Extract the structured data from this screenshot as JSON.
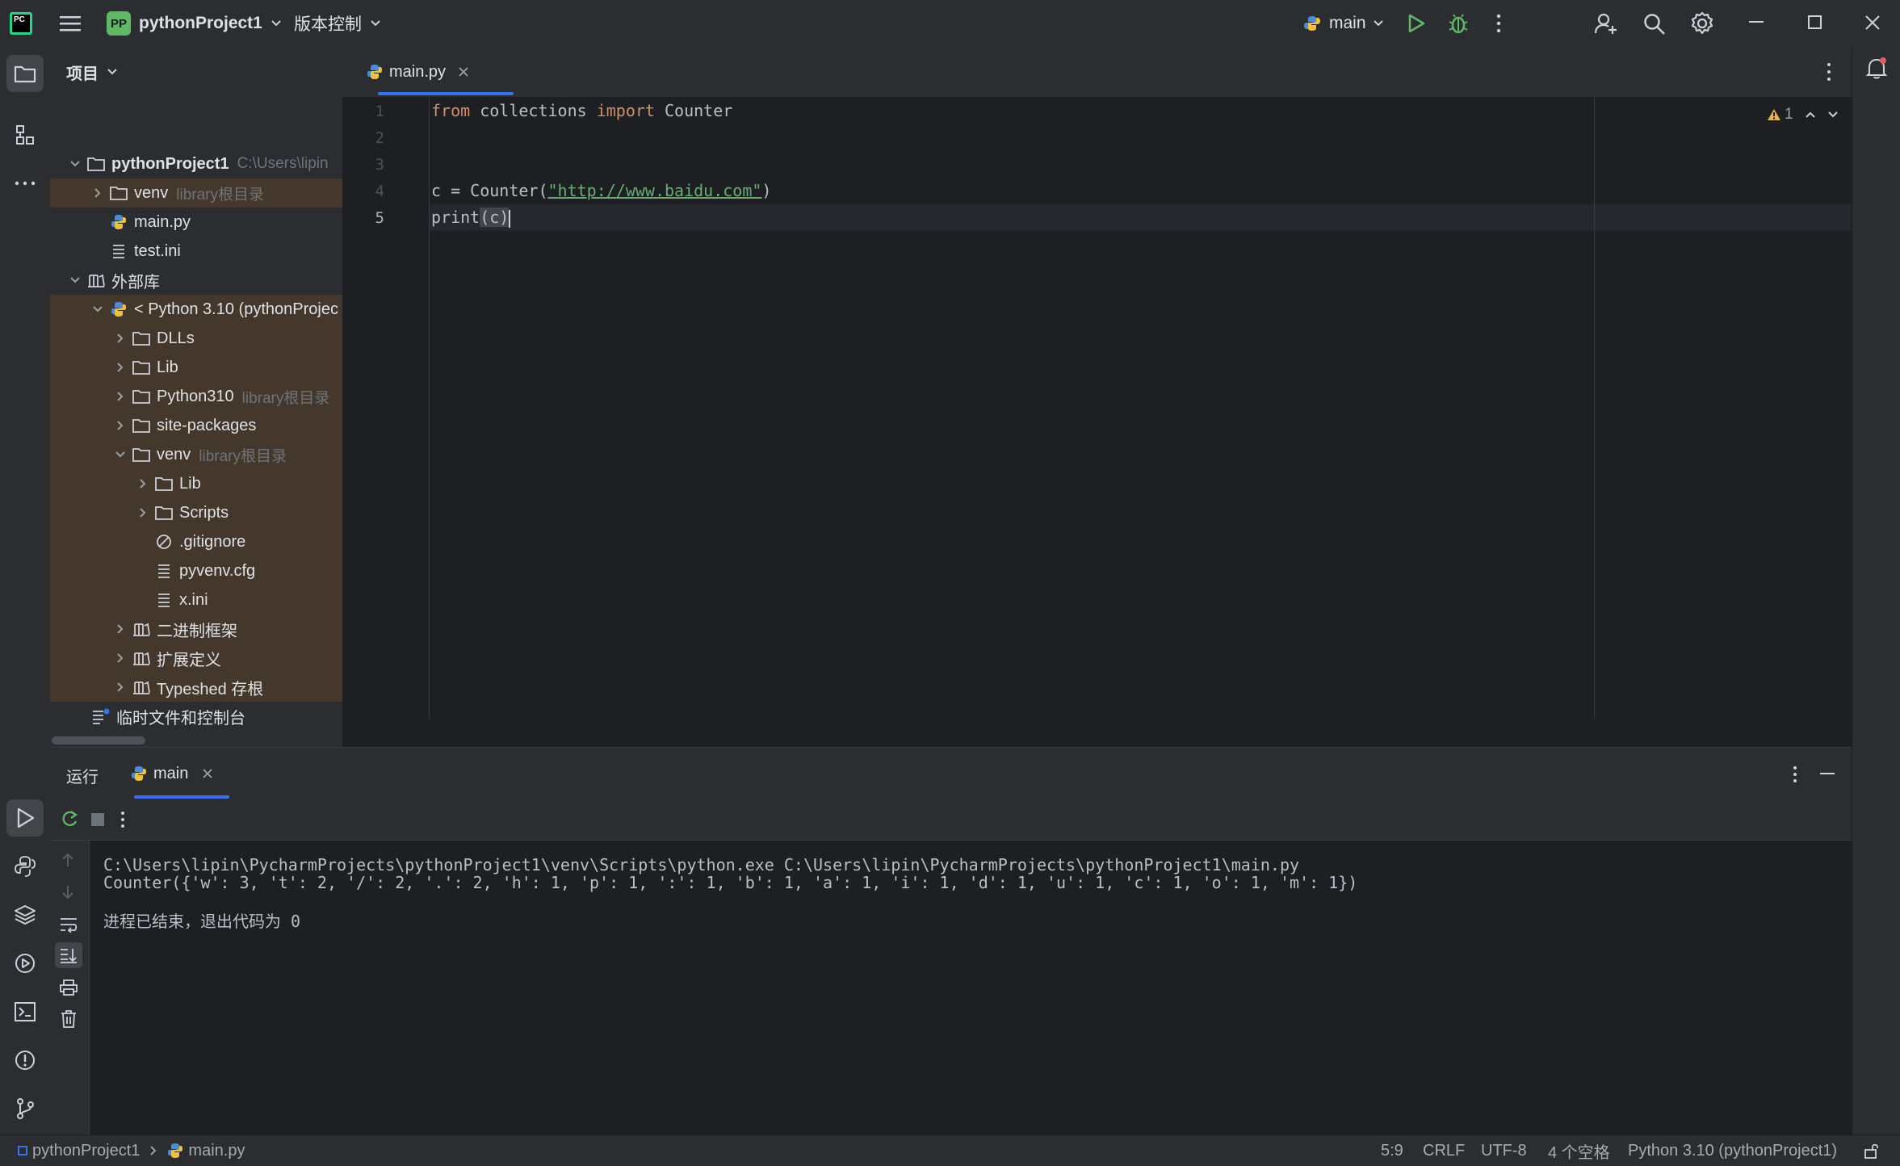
{
  "titlebar": {
    "logo_text": "PC",
    "project_badge": "PP",
    "project_name": "pythonProject1",
    "vcs_label": "版本控制",
    "run_config": "main"
  },
  "project_panel": {
    "header": "项目",
    "tree": [
      {
        "label": "pythonProject1",
        "hint": "C:\\Users\\lipin",
        "icon": "folder-icon"
      },
      {
        "label": "venv",
        "hint": "library根目录",
        "icon": "folder-icon"
      },
      {
        "label": "main.py",
        "hint": "",
        "icon": "python-file-icon"
      },
      {
        "label": "test.ini",
        "hint": "",
        "icon": "text-file-icon"
      },
      {
        "label": "外部库",
        "hint": "",
        "icon": "library-icon"
      },
      {
        "label": "< Python 3.10 (pythonProjec",
        "hint": "",
        "icon": "python-sdk-icon"
      },
      {
        "label": "DLLs",
        "hint": "",
        "icon": "folder-icon"
      },
      {
        "label": "Lib",
        "hint": "",
        "icon": "folder-icon"
      },
      {
        "label": "Python310",
        "hint": "library根目录",
        "icon": "folder-icon"
      },
      {
        "label": "site-packages",
        "hint": "",
        "icon": "folder-icon"
      },
      {
        "label": "venv",
        "hint": "library根目录",
        "icon": "folder-icon"
      },
      {
        "label": "Lib",
        "hint": "",
        "icon": "folder-icon"
      },
      {
        "label": "Scripts",
        "hint": "",
        "icon": "folder-icon"
      },
      {
        "label": ".gitignore",
        "hint": "",
        "icon": "ignore-file-icon"
      },
      {
        "label": "pyvenv.cfg",
        "hint": "",
        "icon": "text-file-icon"
      },
      {
        "label": "x.ini",
        "hint": "",
        "icon": "text-file-icon"
      },
      {
        "label": "二进制框架",
        "hint": "",
        "icon": "library-icon"
      },
      {
        "label": "扩展定义",
        "hint": "",
        "icon": "library-icon"
      },
      {
        "label": "Typeshed 存根",
        "hint": "",
        "icon": "library-icon"
      },
      {
        "label": "临时文件和控制台",
        "hint": "",
        "icon": "scratches-icon"
      }
    ]
  },
  "editor": {
    "tab_label": "main.py",
    "line_numbers": [
      "1",
      "2",
      "3",
      "4",
      "5"
    ],
    "code": {
      "l1_kw1": "from",
      "l1_mod": " collections ",
      "l1_kw2": "import",
      "l1_name": " Counter",
      "l4_pre": "c = Counter(",
      "l4_str": "\"http://www.baidu.com\"",
      "l4_post": ")",
      "l5_fn": "print",
      "l5_args": "(c)"
    },
    "warning_count": "1"
  },
  "run_panel": {
    "title": "运行",
    "tab_label": "main",
    "output": [
      "C:\\Users\\lipin\\PycharmProjects\\pythonProject1\\venv\\Scripts\\python.exe C:\\Users\\lipin\\PycharmProjects\\pythonProject1\\main.py",
      "Counter({'w': 3, 't': 2, '/': 2, '.': 2, 'h': 1, 'p': 1, ':': 1, 'b': 1, 'a': 1, 'i': 1, 'd': 1, 'u': 1, 'c': 1, 'o': 1, 'm': 1})",
      "",
      "进程已结束，退出代码为 0"
    ]
  },
  "statusbar": {
    "breadcrumb_project": "pythonProject1",
    "breadcrumb_file": "main.py",
    "position": "5:9",
    "line_sep": "CRLF",
    "encoding": "UTF-8",
    "indent": "4 个空格",
    "interpreter": "Python 3.10 (pythonProject1)"
  },
  "colors": {
    "accent": "#3574f0",
    "run_green": "#5fb865",
    "warning": "#e0b456",
    "tree_highlight": "#43382b"
  }
}
